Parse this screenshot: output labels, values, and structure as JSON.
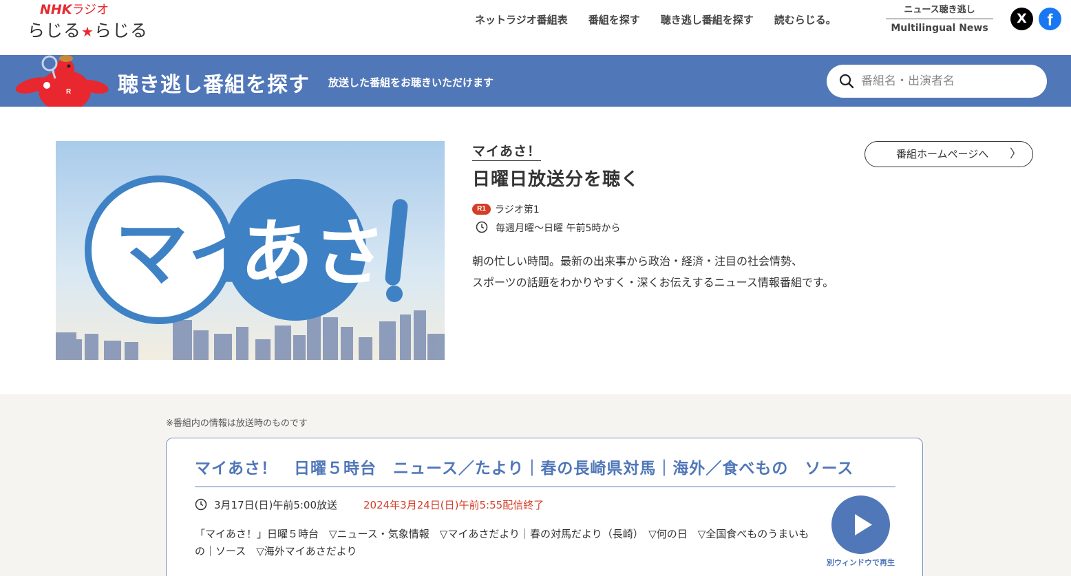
{
  "header": {
    "logo_top_brand": "NHK",
    "logo_top_radio": "ラジオ",
    "logo_bottom_left": "らじる",
    "logo_bottom_star": "★",
    "logo_bottom_right": "らじる",
    "nav": [
      {
        "label": "ネットラジオ番組表"
      },
      {
        "label": "番組を探す"
      },
      {
        "label": "聴き逃し番組を探す"
      },
      {
        "label": "読むらじる。"
      }
    ],
    "nav_stack_top": "ニュース聴き逃し",
    "nav_stack_bottom": "Multilingual News",
    "sns_x": "X",
    "sns_fb": "f"
  },
  "band": {
    "title": "聴き逃し番組を探す",
    "subtitle": "放送した番組をお聴きいただけます",
    "search_placeholder": "番組名・出演者名"
  },
  "program": {
    "hero_text": "マイあさ",
    "hero_exclaim": "!",
    "name": "マイあさ！",
    "title": "日曜日放送分を聴く",
    "homepage_button": "番組ホームページへ",
    "homepage_chevron": "〉",
    "station_badge": "R1",
    "station_name": "ラジオ第1",
    "schedule": "毎週月曜～日曜 午前5時から",
    "description_line1": "朝の忙しい時間。最新の出来事から政治・経済・注目の社会情勢、",
    "description_line2": "スポーツの話題をわかりやすく・深くお伝えするニュース情報番組です。"
  },
  "episode": {
    "note": "※番組内の情報は放送時のものです",
    "title": "マイあさ！　日曜５時台　ニュース／たより｜春の長崎県対馬｜海外／食べもの　ソース",
    "broadcast_date": "3月17日(日)午前5:00放送",
    "expire": "2024年3月24日(日)午前5:55配信終了",
    "body": "「マイあさ！」日曜５時台　▽ニュース・気象情報　▽マイあさだより｜春の対馬だより（長崎）　▽何の日　▽全国食べものうまいもの｜ソース　▽海外マイあさだより",
    "play_label": "別ウィンドウで再生"
  },
  "colors": {
    "accent_blue": "#5077b8",
    "nhk_red": "#e8282e",
    "expire_red": "#d43d27",
    "bg_gray": "#f5f4f0"
  }
}
